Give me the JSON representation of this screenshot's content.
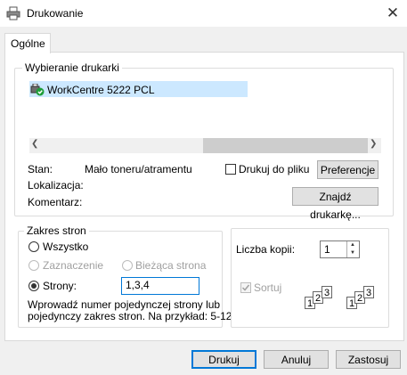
{
  "window": {
    "title": "Drukowanie",
    "close_symbol": "✕"
  },
  "tabs": [
    {
      "label": "Ogólne"
    }
  ],
  "printer_select": {
    "legend": "Wybieranie drukarki",
    "printers": [
      {
        "name": "WorkCentre 5222 PCL",
        "selected": true
      }
    ],
    "scroll_left": "❮",
    "scroll_right": "❯",
    "status_label": "Stan:",
    "status_value": "Mało toneru/atramentu",
    "location_label": "Lokalizacja:",
    "location_value": "",
    "comment_label": "Komentarz:",
    "comment_value": "",
    "print_to_file_label": "Drukuj do pliku",
    "print_to_file_checked": false,
    "preferences_button": "Preferencje",
    "find_printer_button": "Znajdź drukarkę..."
  },
  "page_range": {
    "legend": "Zakres stron",
    "all_label": "Wszystko",
    "selection_label": "Zaznaczenie",
    "current_page_label": "Bieżąca strona",
    "pages_label": "Strony:",
    "pages_value": "1,3,4",
    "selected_option": "pages",
    "hint_line1": "Wprowadź numer pojedynczej strony lub",
    "hint_line2": "pojedynczy zakres stron. Na przykład: 5-12"
  },
  "copies": {
    "label": "Liczba kopii:",
    "value": "1",
    "collate_label": "Sortuj",
    "collate_checked": true,
    "collate_set": [
      "1",
      "2",
      "3"
    ]
  },
  "footer": {
    "print_button": "Drukuj",
    "cancel_button": "Anuluj",
    "apply_button": "Zastosuj"
  },
  "colors": {
    "selection": "#cce8ff",
    "default_border": "#0078d7"
  }
}
